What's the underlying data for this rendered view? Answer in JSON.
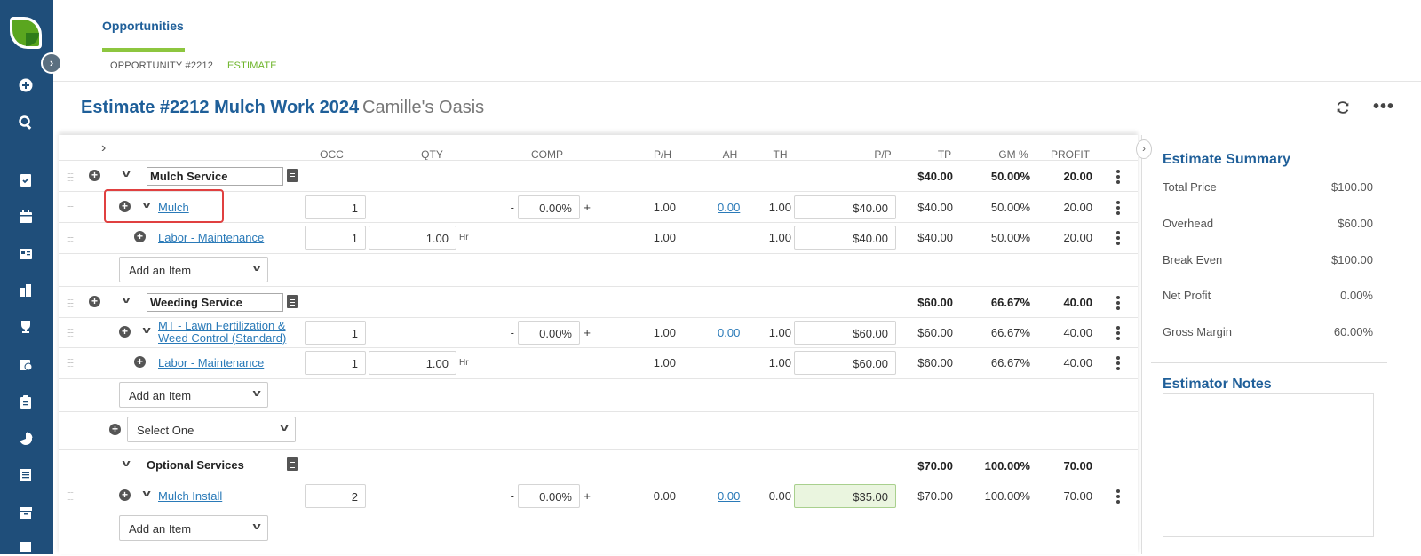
{
  "nav": {
    "tab": "Opportunities",
    "breadcrumb_opportunity": "OPPORTUNITY #2212",
    "breadcrumb_estimate": "ESTIMATE"
  },
  "header": {
    "title": "Estimate #2212 Mulch Work 2024",
    "client": "Camille's Oasis"
  },
  "columns": [
    "OCC",
    "QTY",
    "COMP",
    "P/H",
    "AH",
    "TH",
    "P/P",
    "TP",
    "GM %",
    "PROFIT"
  ],
  "groups": [
    {
      "name": "Mulch Service",
      "tp": "$40.00",
      "gm": "50.00%",
      "profit": "20.00",
      "items": [
        {
          "name": "Mulch",
          "occ": "1",
          "comp": "0.00%",
          "ph": "1.00",
          "ah": "0.00",
          "th": "1.00",
          "pp": "$40.00",
          "tp": "$40.00",
          "gm": "50.00%",
          "profit": "20.00"
        },
        {
          "name": "Labor - Maintenance",
          "occ": "1",
          "qty": "1.00",
          "unit": "Hr",
          "ph": "1.00",
          "th": "1.00",
          "pp": "$40.00",
          "tp": "$40.00",
          "gm": "50.00%",
          "profit": "20.00"
        }
      ],
      "add_item": "Add an Item"
    },
    {
      "name": "Weeding Service",
      "tp": "$60.00",
      "gm": "66.67%",
      "profit": "40.00",
      "items": [
        {
          "name_line1": "MT - Lawn Fertilization &",
          "name_line2": "Weed Control (Standard)",
          "occ": "1",
          "comp": "0.00%",
          "ph": "1.00",
          "ah": "0.00",
          "th": "1.00",
          "pp": "$60.00",
          "tp": "$60.00",
          "gm": "66.67%",
          "profit": "40.00"
        },
        {
          "name": "Labor - Maintenance",
          "occ": "1",
          "qty": "1.00",
          "unit": "Hr",
          "ph": "1.00",
          "th": "1.00",
          "pp": "$60.00",
          "tp": "$60.00",
          "gm": "66.67%",
          "profit": "40.00"
        }
      ],
      "add_item": "Add an Item"
    }
  ],
  "select_one": "Select One",
  "optional": {
    "name": "Optional Services",
    "tp": "$70.00",
    "gm": "100.00%",
    "profit": "70.00",
    "item": {
      "name": "Mulch Install",
      "occ": "2",
      "comp": "0.00%",
      "ph": "0.00",
      "ah": "0.00",
      "th": "0.00",
      "pp": "$35.00",
      "tp": "$70.00",
      "gm": "100.00%",
      "profit": "70.00"
    },
    "add_item": "Add an Item"
  },
  "comp_minus": "-",
  "comp_plus": "+",
  "summary": {
    "title": "Estimate Summary",
    "rows": [
      {
        "label": "Total Price",
        "value": "$100.00"
      },
      {
        "label": "Overhead",
        "value": "$60.00"
      },
      {
        "label": "Break Even",
        "value": "$100.00"
      },
      {
        "label": "Net Profit",
        "value": "0.00%"
      },
      {
        "label": "Gross Margin",
        "value": "60.00%"
      }
    ],
    "notes_title": "Estimator Notes"
  },
  "colors": {
    "sidebar": "#1f4e7a",
    "accent_green": "#8dc63f",
    "title_blue": "#1f5f99",
    "link": "#2a7ab8",
    "highlight": "#e04040"
  }
}
